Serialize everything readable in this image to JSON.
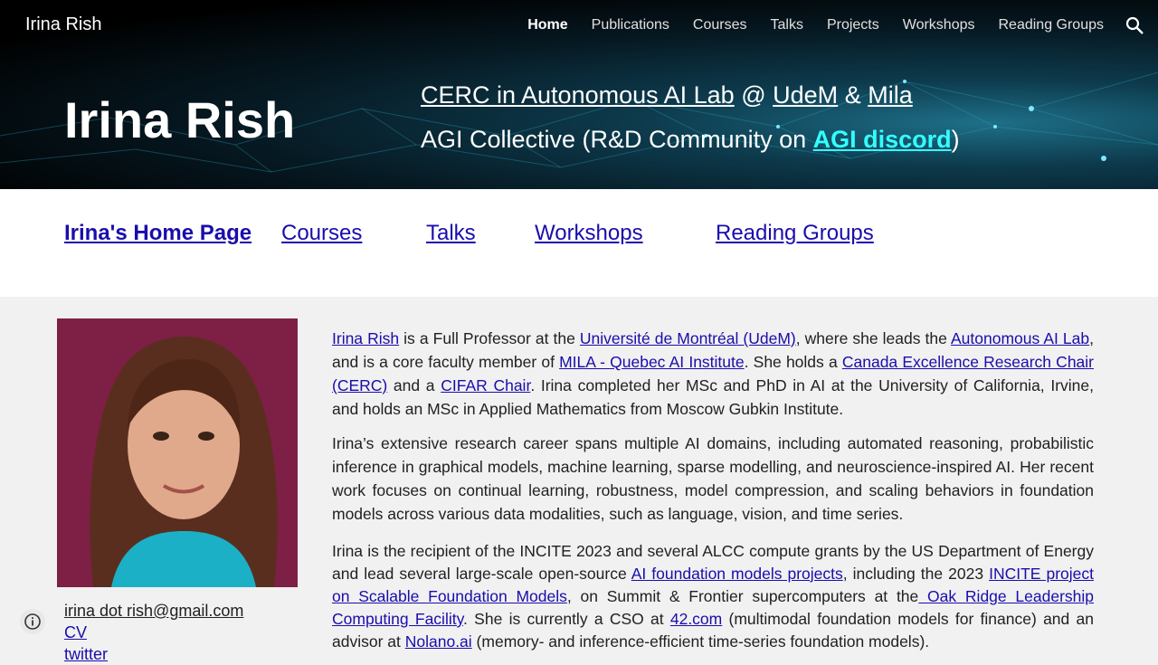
{
  "header": {
    "site_title": "Irina Rish",
    "nav": [
      "Home",
      "Publications",
      "Courses",
      "Talks",
      "Projects",
      "Workshops",
      "Reading Groups"
    ],
    "active": "Home"
  },
  "hero": {
    "name": "Irina Rish",
    "line1": {
      "lab_link": "CERC in Autonomous AI Lab",
      "at": "@",
      "udem": "UdeM",
      "amp": "&",
      "mila": "Mila"
    },
    "line2": {
      "prefix": "AGI Collective  (R&D Community  on ",
      "link": "AGI discord",
      "suffix": ")"
    }
  },
  "linkbar": [
    "Irina's Home Page",
    "Courses",
    "Talks",
    "Workshops",
    "Reading Groups"
  ],
  "contact": {
    "email": "irina dot rish@gmail.com",
    "cv": "CV",
    "twitter": "twitter"
  },
  "bio": {
    "p1": [
      {
        "t": "Irina Rish",
        "link": true
      },
      {
        "t": " is a Full Professor at the "
      },
      {
        "t": "Université de Montréal (UdeM)",
        "link": true
      },
      {
        "t": ", where she leads the "
      },
      {
        "t": "Autonomous AI Lab",
        "link": true
      },
      {
        "t": ", and is a core faculty member of "
      },
      {
        "t": "MILA - Quebec AI Institute",
        "link": true
      },
      {
        "t": ". She holds a "
      },
      {
        "t": "Canada Excellence Research Chair (CERC)",
        "link": true
      },
      {
        "t": " and a "
      },
      {
        "t": " CIFAR Chair",
        "link": true
      },
      {
        "t": ".  Irina completed her MSc and PhD in AI at the University of California, Irvine, and holds an MSc in Applied Mathematics from Moscow Gubkin Institute."
      }
    ],
    "p2": "Irina’s extensive research career spans multiple AI domains, including automated reasoning, probabilistic inference in graphical models, machine learning, sparse modelling, and neuroscience-inspired AI. Her recent work focuses on continual learning, robustness, model compression, and scaling behaviors in foundation models across various data modalities, such as language, vision, and time series.",
    "p3": [
      {
        "t": "Irina is the recipient of the INCITE 2023 and several ALCC compute grants by the US Department of Energy and lead several large-scale open-source "
      },
      {
        "t": "AI foundation models projects",
        "link": true
      },
      {
        "t": ", including the 2023 "
      },
      {
        "t": "INCITE project on Scalable Foundation Models",
        "link": true
      },
      {
        "t": ", on Summit & Frontier supercomputers at the"
      },
      {
        "t": " Oak Ridge Leadership Computing Facility",
        "link": true
      },
      {
        "t": ". She is currently a CSO at "
      },
      {
        "t": "42.com",
        "link": true
      },
      {
        "t": " (multimodal foundation models for finance) and an advisor at "
      },
      {
        "t": "Nolano.ai",
        "link": true
      },
      {
        "t": " (memory- and inference-efficient time-series foundation models)."
      }
    ]
  }
}
